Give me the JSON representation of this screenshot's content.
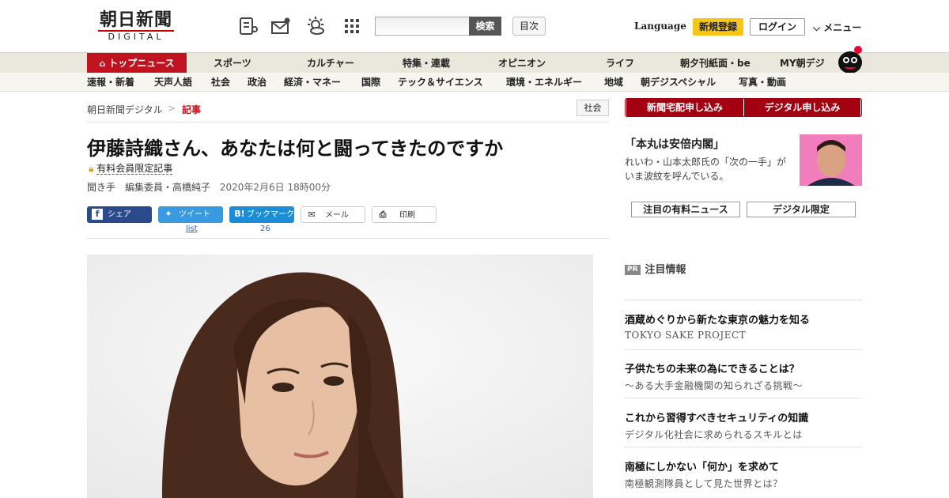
{
  "header": {
    "logo_text": "朝日新聞",
    "logo_sub": "DIGITAL",
    "icons": [
      "news-icon",
      "mail-icon",
      "weather-icon",
      "grid-icon"
    ],
    "search_placeholder": "",
    "search_button": "検索",
    "toc_button": "目次",
    "language": "Language",
    "signup": "新規登録",
    "login": "ログイン",
    "menu": "メニュー"
  },
  "nav_primary": [
    {
      "label": "トップニュース"
    },
    {
      "label": "スポーツ"
    },
    {
      "label": "カルチャー"
    },
    {
      "label": "特集・連載"
    },
    {
      "label": "オピニオン"
    },
    {
      "label": "ライフ"
    },
    {
      "label": "朝夕刊紙面・be"
    },
    {
      "label": "MY朝デジ"
    }
  ],
  "nav_secondary": [
    {
      "label": "速報・新着"
    },
    {
      "label": "天声人語"
    },
    {
      "label": "社会"
    },
    {
      "label": "政治"
    },
    {
      "label": "経済・マネー"
    },
    {
      "label": "国際"
    },
    {
      "label": "テック＆サイエンス"
    },
    {
      "label": "環境・エネルギー"
    },
    {
      "label": "地域"
    },
    {
      "label": "朝デジスペシャル"
    },
    {
      "label": "写真・動画"
    }
  ],
  "breadcrumb": {
    "home": "朝日新聞デジタル",
    "sep": ">",
    "current": "記事"
  },
  "category": "社会",
  "article": {
    "title": "伊藤詩織さん、あなたは何と闘ってきたのですか",
    "members_only": "有料会員限定記事",
    "byline": "聞き手　編集委員・高橋純子",
    "date": "2020年2月6日 18時00分"
  },
  "share": {
    "facebook": "シェア",
    "twitter": "ツイート",
    "twitter_sub": "list",
    "hatena": "ブックマーク",
    "hatena_count": "26",
    "mail": "メール",
    "print": "印刷"
  },
  "sidebar": {
    "subscribe_paper": "新聞宅配申し込み",
    "subscribe_digital": "デジタル申し込み",
    "promo_title": "「本丸は安倍内閣」",
    "promo_text": "れいわ・山本太郎氏の「次の一手」がいま波紋を呼んでいる。",
    "tab_featured": "注目の有料ニュース",
    "tab_digital": "デジタル限定",
    "pr_badge": "PR",
    "pr_heading": "注目情報",
    "pr_items": [
      {
        "title": "酒蔵めぐりから新たな東京の魅力を知る",
        "sub": "TOKYO SAKE PROJECT"
      },
      {
        "title": "子供たちの未来の為にできることは？",
        "sub": "～ある大手金融機関の知られざる挑戦～"
      },
      {
        "title": "これから習得すべきセキュリティの知識",
        "sub": "デジタル化社会に求められるスキルとは"
      },
      {
        "title": "南極にしかない「何か」を求めて",
        "sub": "南極観測隊員として見た世界とは？"
      }
    ]
  },
  "colors": {
    "brand_red": "#c1121f",
    "signup_yellow": "#f5c518",
    "subscribe_red": "#a30012"
  }
}
